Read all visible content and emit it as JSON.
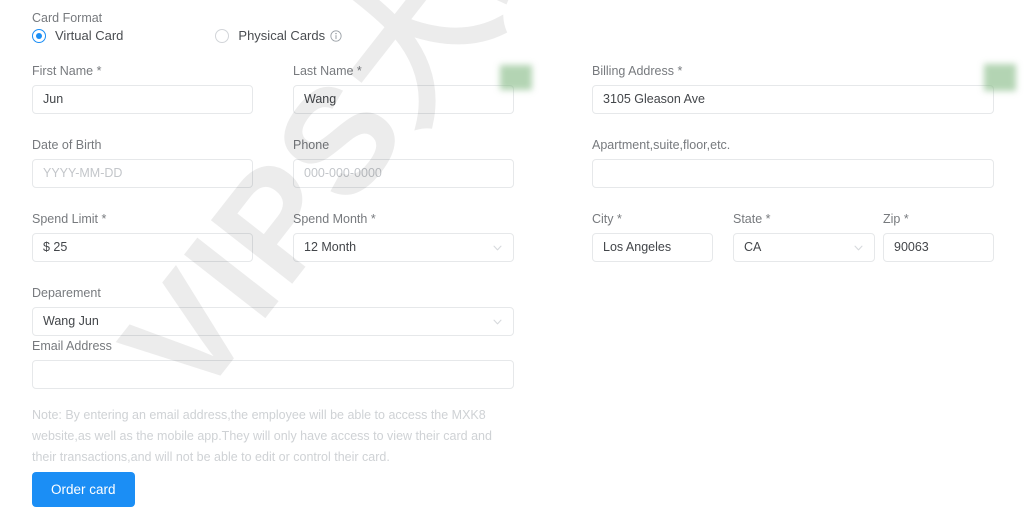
{
  "card_format": {
    "label": "Card Format",
    "options": [
      {
        "label": "Virtual Card",
        "selected": true
      },
      {
        "label": "Physical Cards",
        "selected": false,
        "info_icon": "info-icon"
      }
    ]
  },
  "left_column": {
    "first_name": {
      "label": "First Name *",
      "value": "Jun",
      "placeholder": ""
    },
    "last_name": {
      "label": "Last Name *",
      "value": "Wang",
      "placeholder": ""
    },
    "date_of_birth": {
      "label": "Date of Birth",
      "value": "",
      "placeholder": "YYYY-MM-DD"
    },
    "phone": {
      "label": "Phone",
      "value": "",
      "placeholder": "000-000-0000"
    },
    "spend_limit": {
      "label": "Spend Limit *",
      "value": "$ 25",
      "placeholder": ""
    },
    "spend_month": {
      "label": "Spend Month *",
      "value": "12 Month",
      "placeholder": "",
      "icon": "chevron-down-icon"
    },
    "deparement": {
      "label": "Deparement",
      "value": "Wang Jun",
      "placeholder": "",
      "icon": "chevron-down-icon"
    },
    "email_address": {
      "label": "Email Address",
      "value": "",
      "placeholder": ""
    }
  },
  "right_column": {
    "billing_address": {
      "label": "Billing Address *",
      "value": "3105 Gleason Ave",
      "placeholder": ""
    },
    "apartment": {
      "label": "Apartment,suite,floor,etc.",
      "value": "",
      "placeholder": ""
    },
    "city": {
      "label": "City *",
      "value": "Los Angeles",
      "placeholder": ""
    },
    "state": {
      "label": "State *",
      "value": "CA",
      "placeholder": "",
      "icon": "chevron-down-icon"
    },
    "zip": {
      "label": "Zip *",
      "value": "90063",
      "placeholder": ""
    }
  },
  "note": "Note: By entering an email address,the employee will be able to access the MXK8 website,as well as the mobile app.They will only have access to view their card and their transactions,and will not be able to edit or control their card.",
  "submit": {
    "label": "Order card"
  },
  "watermark": {
    "text": "VIPS大玩家"
  },
  "colors": {
    "accent": "#1b8ef5",
    "label": "#777a7e",
    "value": "#43464a",
    "placeholder": "#c3c6ca",
    "border": "#e6e8ea",
    "note": "#cfd2d5",
    "redaction": "#84ba84"
  }
}
